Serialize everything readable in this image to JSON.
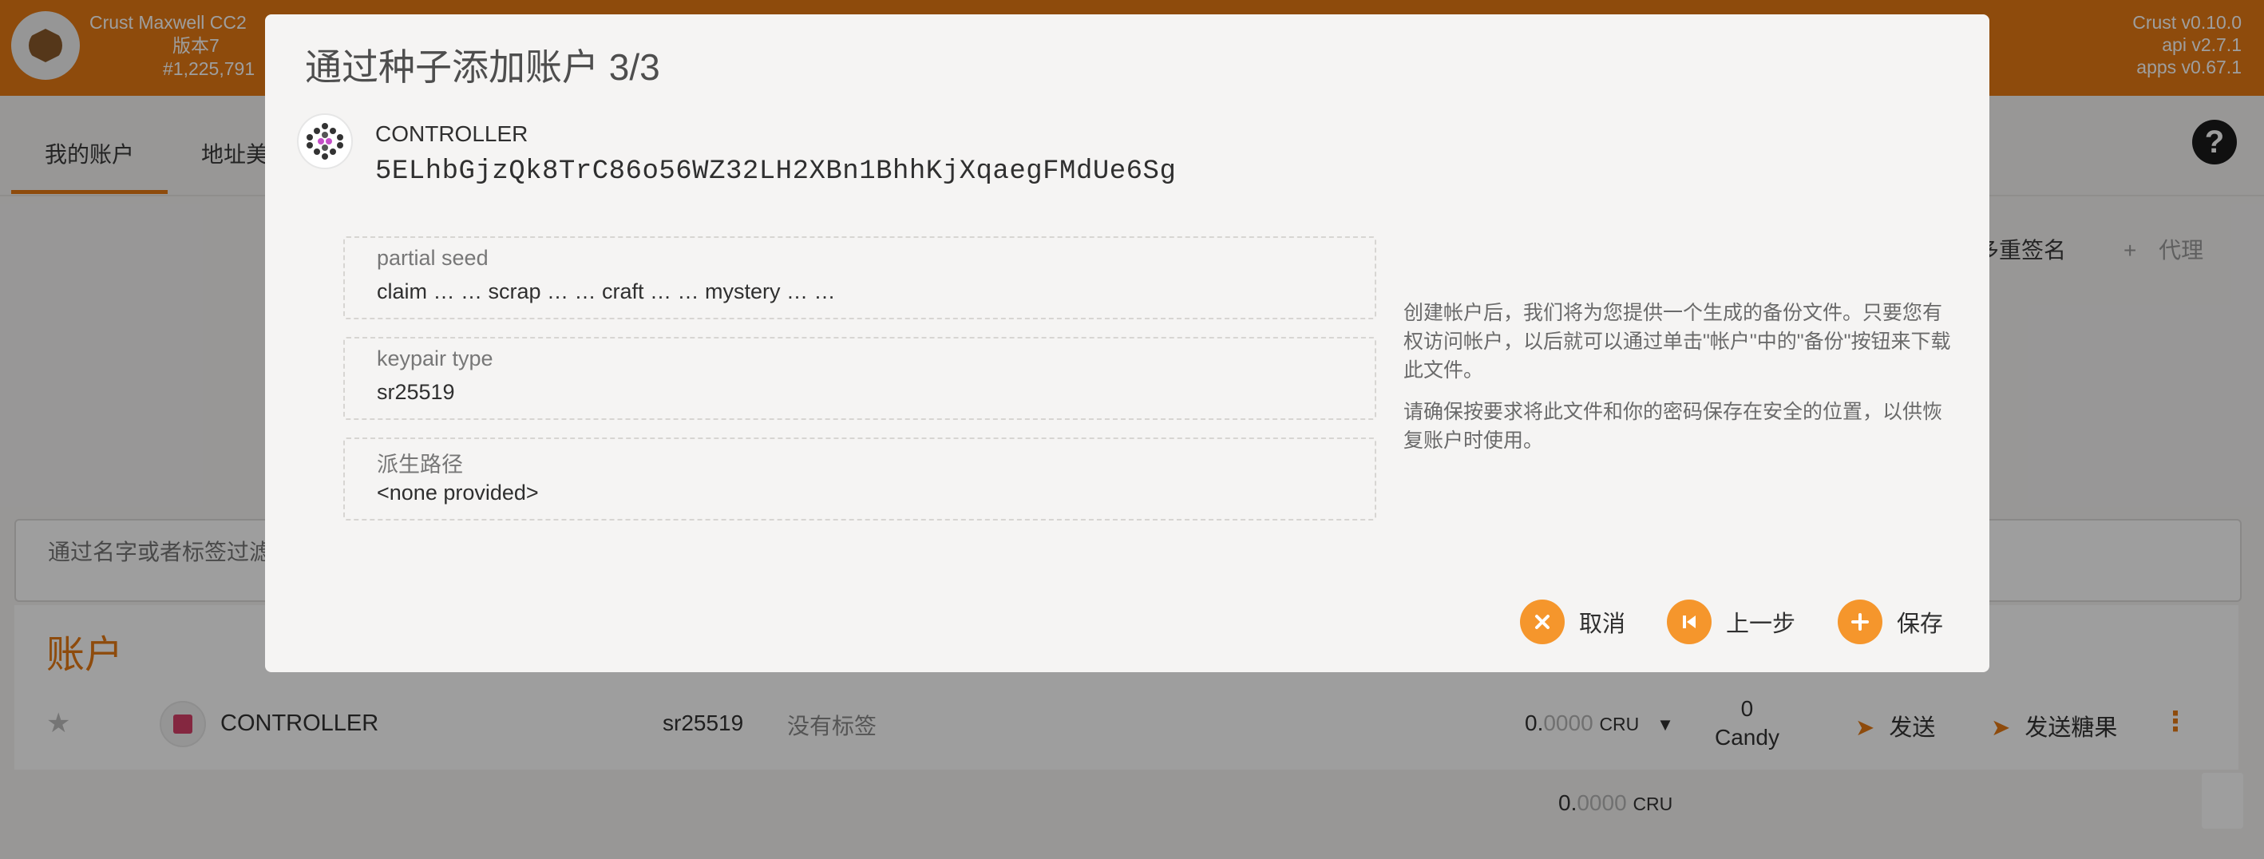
{
  "header": {
    "chain_name": "Crust Maxwell CC2",
    "version_line": "版本7",
    "block_number": "#1,225,791",
    "versions": [
      "Crust v0.10.0",
      "api v2.7.1",
      "apps v0.67.1"
    ]
  },
  "nav": {
    "tabs": [
      {
        "label": "我的账户",
        "active": true
      },
      {
        "label": "地址美",
        "active": false
      }
    ],
    "help": "?"
  },
  "actions": {
    "multisig": "多重签名",
    "proxy": "代理",
    "proxy_icon": "+"
  },
  "filter": {
    "placeholder": "通过名字或者标签过滤"
  },
  "accounts": {
    "title": "账户",
    "rows": [
      {
        "name": "CONTROLLER",
        "type": "sr25519",
        "tags": "没有标签",
        "balance_int": "0.",
        "balance_dec": "0000",
        "balance_unit": "CRU",
        "candy_value": "0",
        "candy_unit": "Candy",
        "send_label": "发送",
        "send_candy_label": "发送糖果"
      }
    ],
    "total": {
      "balance_int": "0.",
      "balance_dec": "0000",
      "balance_unit": "CRU"
    }
  },
  "modal": {
    "title": "通过种子添加账户 3/3",
    "account_name": "CONTROLLER",
    "account_address": "5ELhbGjzQk8TrC86o56WZ32LH2XBn1BhhKjXqaegFMdUe6Sg",
    "fields": [
      {
        "label": "partial seed",
        "value": "claim … … scrap … … craft … … mystery … …"
      },
      {
        "label": "keypair type",
        "value": "sr25519"
      },
      {
        "label": "派生路径",
        "value": "<none provided>"
      }
    ],
    "help_paragraphs": [
      "创建帐户后，我们将为您提供一个生成的备份文件。只要您有权访问帐户，以后就可以通过单击\"帐户\"中的\"备份\"按钮来下载此文件。",
      "请确保按要求将此文件和你的密码保存在安全的位置，以供恢复账户时使用。"
    ],
    "buttons": {
      "cancel": "取消",
      "previous": "上一步",
      "save": "保存"
    }
  },
  "colors": {
    "brand": "#e57a14",
    "button": "#f5962c",
    "background": "#f5f4f3"
  },
  "icons": {
    "logo": "crust-logo-icon",
    "help": "help-icon",
    "star": "star-icon",
    "send": "paper-plane-icon",
    "menu": "vertical-dots-icon",
    "dropdown": "caret-down-icon",
    "cancel": "x-icon",
    "previous": "skip-back-icon",
    "save": "plus-icon"
  }
}
